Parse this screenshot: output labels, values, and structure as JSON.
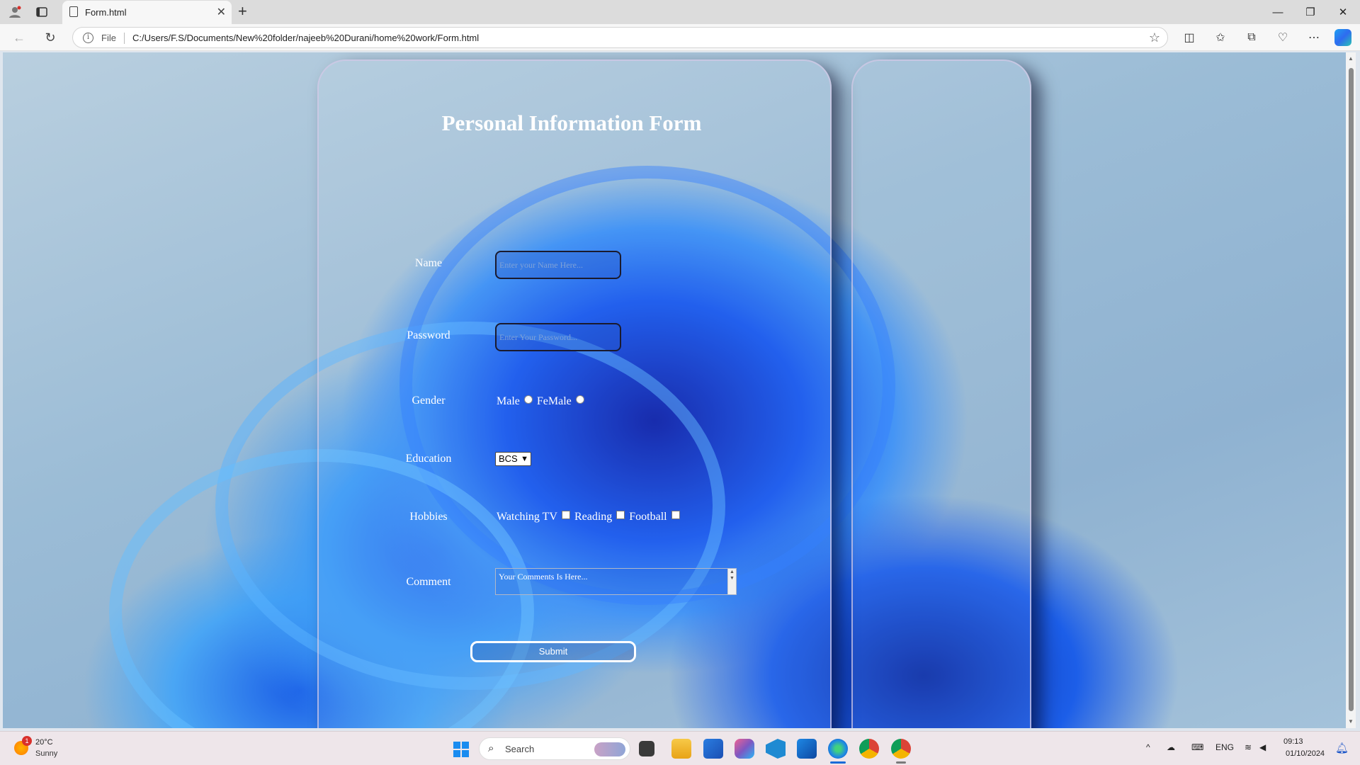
{
  "browser": {
    "tab_title": "Form.html",
    "address_scheme": "File",
    "address_url": "C:/Users/F.S/Documents/New%20folder/najeeb%20Durani/home%20work/Form.html"
  },
  "form": {
    "title": "Personal Information Form",
    "name_label": "Name",
    "name_placeholder": "Enter your Name Here...",
    "password_label": "Password",
    "password_placeholder": "Enter Your Password...",
    "gender_label": "Gender",
    "gender_options": [
      "Male",
      "FeMale"
    ],
    "education_label": "Education",
    "education_selected": "BCS",
    "hobbies_label": "Hobbies",
    "hobbies_options": [
      "Watching TV",
      "Reading",
      "Football"
    ],
    "comment_label": "Comment",
    "comment_placeholder": "Your Comments Is Here...",
    "submit_label": "Submit"
  },
  "taskbar": {
    "weather_temp": "20°C",
    "weather_desc": "Sunny",
    "weather_badge": "1",
    "search_placeholder": "Search",
    "lang": "ENG",
    "time": "09:13",
    "date": "01/10/2024"
  },
  "colors": {
    "accent": "#1a8cf0",
    "card_border": "#d2c8e6"
  }
}
